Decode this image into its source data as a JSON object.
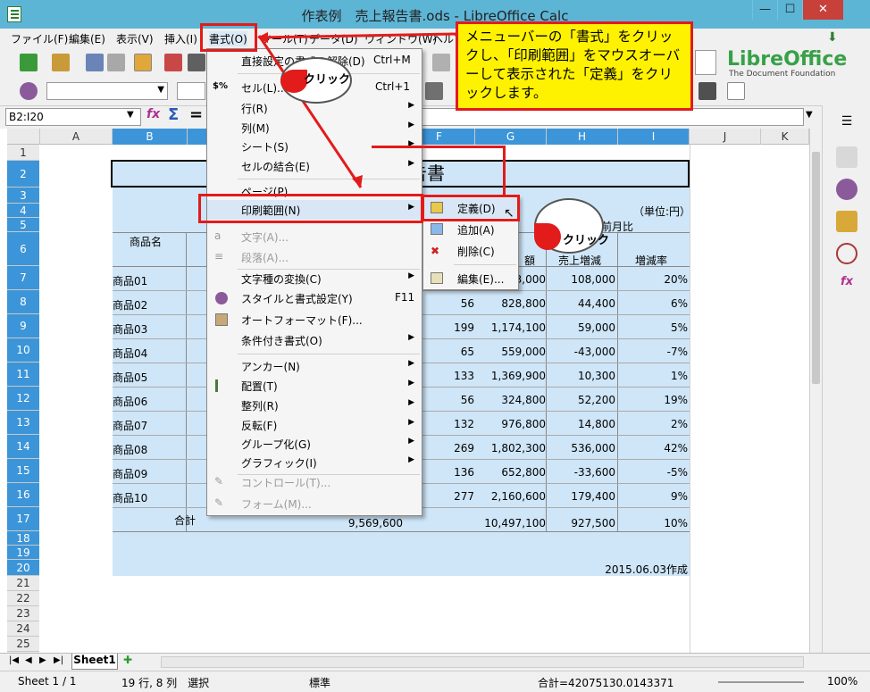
{
  "window": {
    "title": "作表例　売上報告書.ods - LibreOffice Calc",
    "min": "—",
    "max": "☐",
    "close": "✕"
  },
  "menubar": [
    "ファイル(F)",
    "編集(E)",
    "表示(V)",
    "挿入(I)",
    "書式(O)",
    "ツール(T)",
    "データ(D)",
    "ウィンドウ(W)",
    "ヘルプ(H)"
  ],
  "logo": {
    "name": "LibreOffice",
    "sub": "The Document Foundation"
  },
  "namebox": "B2:I20",
  "columns": [
    "A",
    "B",
    "C",
    "D",
    "E",
    "F",
    "G",
    "H",
    "I",
    "J",
    "K"
  ],
  "rows": [
    "1",
    "2",
    "3",
    "4",
    "5",
    "6",
    "7",
    "8",
    "9",
    "10",
    "11",
    "12",
    "13",
    "14",
    "15",
    "16",
    "17",
    "18",
    "19",
    "20",
    "21",
    "22",
    "23",
    "24",
    "25"
  ],
  "sheet": {
    "title": "売上報告書",
    "unit": "（単位:円）",
    "header_product": "商品名",
    "header_prev": "前月比",
    "header_amount_partial": "額",
    "header_increase": "売上増減",
    "header_rate": "増減率",
    "products": [
      "商品01",
      "商品02",
      "商品03",
      "商品04",
      "商品05",
      "商品06",
      "商品07",
      "商品08",
      "商品09",
      "商品10"
    ],
    "qty": [
      "",
      "56",
      "199",
      "65",
      "133",
      "56",
      "132",
      "269",
      "136",
      "277"
    ],
    "sales": [
      "3,000",
      "828,800",
      "1,174,100",
      "559,000",
      "1,369,900",
      "324,800",
      "976,800",
      "1,802,300",
      "652,800",
      "2,160,600"
    ],
    "diff": [
      "108,000",
      "44,400",
      "59,000",
      "-43,000",
      "10,300",
      "52,200",
      "14,800",
      "536,000",
      "-33,600",
      "179,400"
    ],
    "rate": [
      "20%",
      "6%",
      "5%",
      "-7%",
      "1%",
      "19%",
      "2%",
      "42%",
      "-5%",
      "9%"
    ],
    "total_label": "合計",
    "total_prev": "9,569,600",
    "total_sales": "10,497,100",
    "total_diff": "927,500",
    "total_rate": "10%",
    "created": "2015.06.03作成"
  },
  "format_menu": [
    {
      "label": "直接設定の書式の解除(D)",
      "shortcut": "Ctrl+M"
    },
    {
      "label": "セル(L)...",
      "shortcut": "Ctrl+1"
    },
    {
      "label": "行(R)"
    },
    {
      "label": "列(M)"
    },
    {
      "label": "シート(S)"
    },
    {
      "label": "セルの結合(E)"
    },
    {
      "label": "ページ(P)..."
    },
    {
      "label": "印刷範囲(N)"
    },
    {
      "label": "文字(A)..."
    },
    {
      "label": "段落(A)..."
    },
    {
      "label": "文字種の変換(C)"
    },
    {
      "label": "スタイルと書式設定(Y)",
      "shortcut": "F11"
    },
    {
      "label": "オートフォーマット(F)..."
    },
    {
      "label": "条件付き書式(O)"
    },
    {
      "label": "アンカー(N)"
    },
    {
      "label": "配置(T)"
    },
    {
      "label": "整列(R)"
    },
    {
      "label": "反転(F)"
    },
    {
      "label": "グループ化(G)"
    },
    {
      "label": "グラフィック(I)"
    },
    {
      "label": "コントロール(T)..."
    },
    {
      "label": "フォーム(M)..."
    }
  ],
  "print_range_menu": [
    {
      "label": "定義(D)"
    },
    {
      "label": "追加(A)"
    },
    {
      "label": "削除(C)"
    },
    {
      "label": "編集(E)..."
    }
  ],
  "callout": "メニューバーの「書式」をクリックし、「印刷範囲」をマウスオーバーして表示された「定義」をクリックします。",
  "click_label": "クリック",
  "tabs": {
    "sheet": "Sheet1"
  },
  "status": {
    "sheet": "Sheet 1 / 1",
    "sel": "19 行, 8 列　選択",
    "style": "標準",
    "sum": "合計=42075130.0143371",
    "zoom": "100%"
  },
  "colors": {
    "accent": "#e21b1b",
    "callout_bg": "#fff200",
    "selection": "#cfe6f8",
    "header_sel": "#3c95d8"
  }
}
